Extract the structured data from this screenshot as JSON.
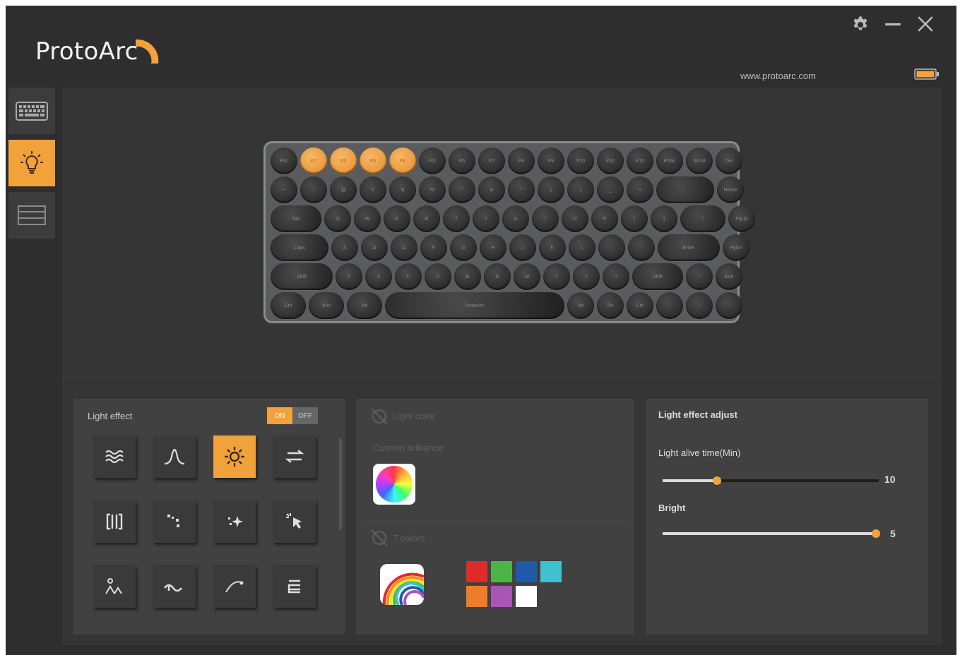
{
  "header": {
    "brand": "ProtoArc",
    "website": "www.protoarc.com",
    "icons": [
      "settings-gear-icon",
      "minimize-icon",
      "close-icon",
      "battery-icon"
    ],
    "accent_color": "#f2a23a",
    "battery_color": "#f2a23a"
  },
  "sidebar": {
    "items": [
      {
        "name": "keyboard",
        "icon": "keyboard-icon",
        "active": false
      },
      {
        "name": "lighting",
        "icon": "light-bulb-icon",
        "active": true
      },
      {
        "name": "macros",
        "icon": "list-icon",
        "active": false
      }
    ]
  },
  "keyboard": {
    "highlight_color": "#e8963a",
    "rows": [
      [
        {
          "label": "Esc",
          "w": "r"
        },
        {
          "label": "F1",
          "w": "r",
          "hl": true
        },
        {
          "label": "F2",
          "w": "r",
          "hl": true
        },
        {
          "label": "F3",
          "w": "r",
          "hl": true
        },
        {
          "label": "F4",
          "w": "r",
          "hl": true
        },
        {
          "label": "F5",
          "w": "r"
        },
        {
          "label": "F6",
          "w": "r"
        },
        {
          "label": "F7",
          "w": "r"
        },
        {
          "label": "F8",
          "w": "r"
        },
        {
          "label": "F9",
          "w": "r"
        },
        {
          "label": "F10",
          "w": "r"
        },
        {
          "label": "F11",
          "w": "r"
        },
        {
          "label": "F12",
          "w": "r"
        },
        {
          "label": "PrtSc",
          "w": "r"
        },
        {
          "label": "Scroll",
          "w": "r"
        },
        {
          "label": "Del",
          "w": "r"
        }
      ],
      [
        {
          "label": "~",
          "w": "r"
        },
        {
          "label": "!",
          "w": "r"
        },
        {
          "label": "@",
          "w": "r"
        },
        {
          "label": "#",
          "w": "r"
        },
        {
          "label": "$",
          "w": "r"
        },
        {
          "label": "%",
          "w": "r"
        },
        {
          "label": "^",
          "w": "r"
        },
        {
          "label": "&",
          "w": "r"
        },
        {
          "label": "*",
          "w": "r"
        },
        {
          "label": "(",
          "w": "r"
        },
        {
          "label": ")",
          "w": "r"
        },
        {
          "label": "_",
          "w": "r"
        },
        {
          "label": "+",
          "w": "r"
        },
        {
          "label": "←",
          "w": "w82"
        },
        {
          "label": "Home",
          "w": "r"
        }
      ],
      [
        {
          "label": "Tab",
          "w": "w72"
        },
        {
          "label": "Q",
          "w": "r"
        },
        {
          "label": "W",
          "w": "r"
        },
        {
          "label": "E",
          "w": "r"
        },
        {
          "label": "R",
          "w": "r"
        },
        {
          "label": "T",
          "w": "r"
        },
        {
          "label": "Y",
          "w": "r"
        },
        {
          "label": "U",
          "w": "r"
        },
        {
          "label": "I",
          "w": "r"
        },
        {
          "label": "O",
          "w": "r"
        },
        {
          "label": "P",
          "w": "r"
        },
        {
          "label": "[",
          "w": "r"
        },
        {
          "label": "]",
          "w": "r"
        },
        {
          "label": "\\",
          "w": "w64"
        },
        {
          "label": "PgUp",
          "w": "r"
        }
      ],
      [
        {
          "label": "Caps",
          "w": "w82"
        },
        {
          "label": "A",
          "w": "r"
        },
        {
          "label": "S",
          "w": "r"
        },
        {
          "label": "D",
          "w": "r"
        },
        {
          "label": "F",
          "w": "r"
        },
        {
          "label": "G",
          "w": "r"
        },
        {
          "label": "H",
          "w": "r"
        },
        {
          "label": "J",
          "w": "r"
        },
        {
          "label": "K",
          "w": "r"
        },
        {
          "label": "L",
          "w": "r"
        },
        {
          "label": ";",
          "w": "r"
        },
        {
          "label": "'",
          "w": "r"
        },
        {
          "label": "Enter",
          "w": "w88"
        },
        {
          "label": "PgDn",
          "w": "r"
        }
      ],
      [
        {
          "label": "Shift",
          "w": "w88"
        },
        {
          "label": "Z",
          "w": "r"
        },
        {
          "label": "X",
          "w": "r"
        },
        {
          "label": "C",
          "w": "r"
        },
        {
          "label": "V",
          "w": "r"
        },
        {
          "label": "B",
          "w": "r"
        },
        {
          "label": "N",
          "w": "r"
        },
        {
          "label": "M",
          "w": "r"
        },
        {
          "label": "<",
          "w": "r"
        },
        {
          "label": ">",
          "w": "r"
        },
        {
          "label": "?",
          "w": "r"
        },
        {
          "label": "Shift",
          "w": "w72"
        },
        {
          "label": "↑",
          "w": "r"
        },
        {
          "label": "End",
          "w": "r"
        }
      ],
      [
        {
          "label": "Ctrl",
          "w": "w55"
        },
        {
          "label": "Win",
          "w": "w55"
        },
        {
          "label": "Alt",
          "w": "w55"
        },
        {
          "label": "ProtoArc",
          "w": "space"
        },
        {
          "label": "Alt",
          "w": "r"
        },
        {
          "label": "Fn",
          "w": "r"
        },
        {
          "label": "Ctrl",
          "w": "r"
        },
        {
          "label": "←",
          "w": "r"
        },
        {
          "label": "↓",
          "w": "r"
        },
        {
          "label": "→",
          "w": "r"
        }
      ]
    ]
  },
  "light_effect": {
    "title": "Light effect",
    "on_label": "ON",
    "off_label": "OFF",
    "enabled": true,
    "effects": [
      {
        "icon": "wave-icon",
        "active": false
      },
      {
        "icon": "breathing-icon",
        "active": false
      },
      {
        "icon": "static-sun-icon",
        "active": true
      },
      {
        "icon": "switch-arrows-icon",
        "active": false
      },
      {
        "icon": "bracket-icon",
        "active": false
      },
      {
        "icon": "scatter-dots-icon",
        "active": false
      },
      {
        "icon": "sparkle-icon",
        "active": false
      },
      {
        "icon": "click-ripple-icon",
        "active": false
      },
      {
        "icon": "landscape-icon",
        "active": false
      },
      {
        "icon": "wave-line-icon",
        "active": false
      },
      {
        "icon": "curve-arrow-icon",
        "active": false
      },
      {
        "icon": "return-arrows-icon",
        "active": false
      }
    ]
  },
  "light_color": {
    "title": "Light color",
    "custom_label": "Custom brilliance",
    "preset_title": "7 colors",
    "icons": [
      "color-disabled-icon",
      "color-wheel-icon",
      "rainbow-icon"
    ],
    "swatches": [
      "#e32a2a",
      "#4db448",
      "#1f5aa8",
      "#3ec2cf",
      "#ee7d2a",
      "#a955b8",
      "#ffffff"
    ]
  },
  "light_adjust": {
    "title": "Light effect adjust",
    "alive_label": "Light alive time(Min)",
    "alive_value": "10",
    "alive_fraction": 0.25,
    "bright_label": "Bright",
    "bright_value": "5",
    "bright_fraction": 1.0
  }
}
